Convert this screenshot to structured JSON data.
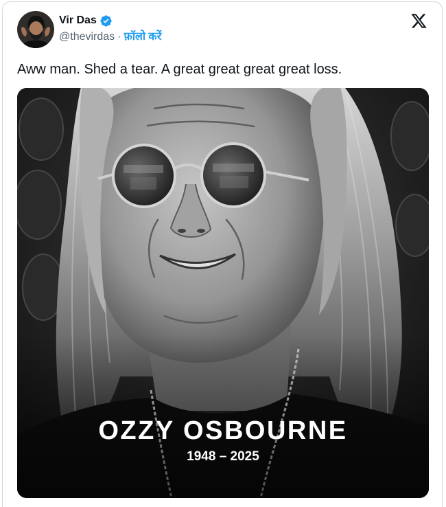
{
  "tweet": {
    "author": {
      "name": "Vir Das",
      "verified": true,
      "handle": "@thevirdas",
      "separator": "·",
      "follow_label": "फ़ॉलो करें"
    },
    "text": "Aww man. Shed a tear. A great great great great loss.",
    "media": {
      "title": "OZZY OSBOURNE",
      "years": "1948 – 2025"
    }
  },
  "icons": {
    "avatar": "avatar",
    "verified": "verified-badge-icon",
    "brand": "x-logo-icon"
  },
  "colors": {
    "accent": "#1d9bf0",
    "text": "#0f1419",
    "muted": "#536471",
    "border": "#cfd9de",
    "overlay_text": "#ffffff"
  }
}
